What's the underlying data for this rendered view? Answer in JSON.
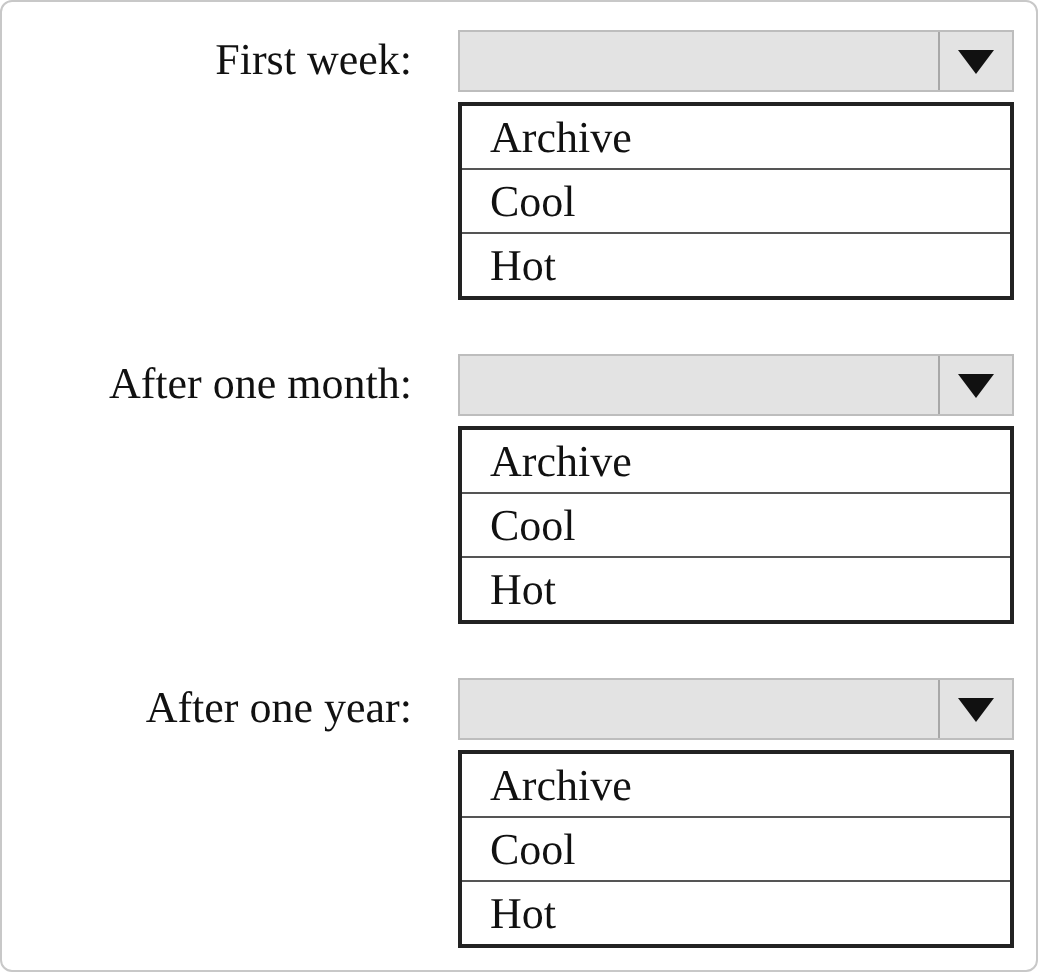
{
  "questions": [
    {
      "label": "First week:",
      "options": [
        "Archive",
        "Cool",
        "Hot"
      ]
    },
    {
      "label": "After one month:",
      "options": [
        "Archive",
        "Cool",
        "Hot"
      ]
    },
    {
      "label": "After one year:",
      "options": [
        "Archive",
        "Cool",
        "Hot"
      ]
    }
  ]
}
